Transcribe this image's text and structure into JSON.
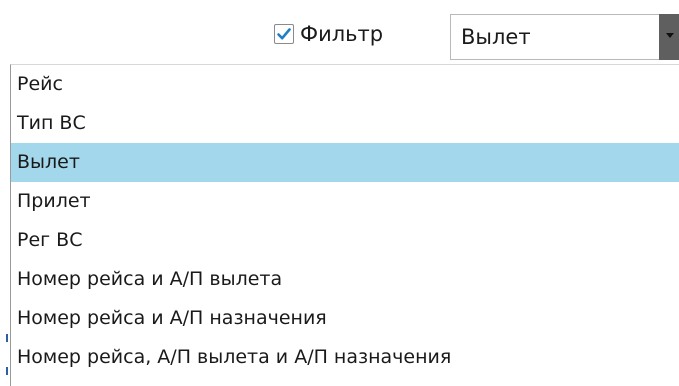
{
  "filter": {
    "checked": true,
    "label": "Фильтр"
  },
  "combo": {
    "value": "Вылет",
    "arrow_icon": "chevron-down-icon"
  },
  "options": [
    "Рейс",
    "Тип ВС",
    "Вылет",
    "Прилет",
    "Рег ВС",
    "Номер рейса и А/П вылета",
    "Номер рейса и А/П назначения",
    "Номер рейса, А/П вылета и А/П назначения"
  ],
  "selected_option": "Вылет",
  "colors": {
    "selection": "#a3d7eb",
    "checkmark": "#1f7fc4",
    "combo_button": "#5f5f5f"
  }
}
